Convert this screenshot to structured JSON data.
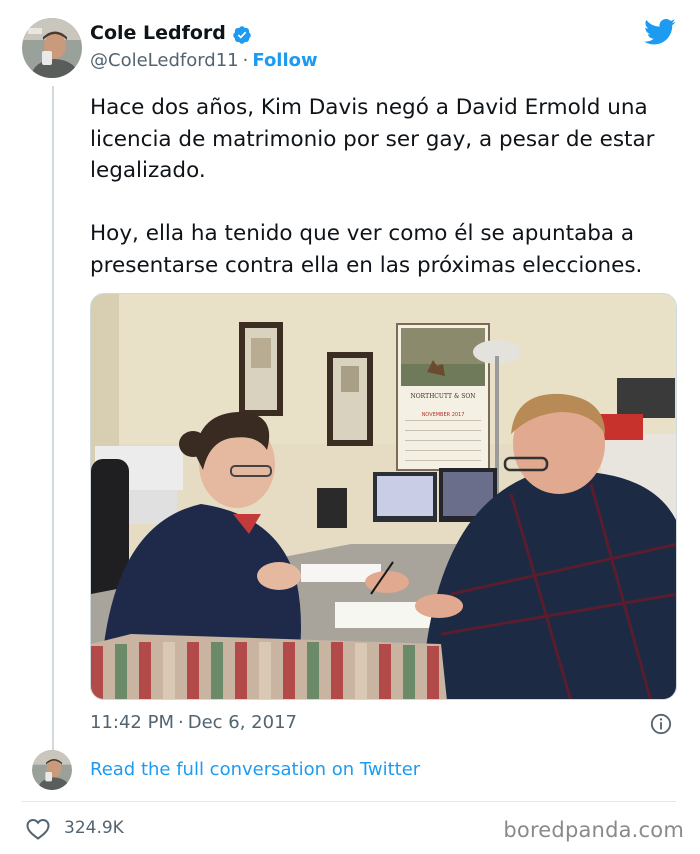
{
  "tweet": {
    "author": {
      "name": "Cole Ledford",
      "handle": "@ColeLedford11",
      "verified": true,
      "follow_label": "Follow",
      "separator": "·"
    },
    "text": "Hace dos años, Kim Davis negó a David Ermold una\nlicencia de matrimonio por ser gay, a pesar de estar\nlegalizado.\n\nHoy, ella ha tenido que ver como él se apuntaba a\npresentarse contra ella en las próximas elecciones.",
    "photo": {
      "calendar_brand": "NORTHCUTT & SON",
      "calendar_month": "NOVEMBER 2017"
    },
    "time": "11:42 PM",
    "date": "Dec 6, 2017",
    "likes": "324.9K",
    "read_more_label": "Read the full conversation on Twitter"
  },
  "icons": {
    "brand": "twitter-bird-icon",
    "verified": "verified-badge-icon",
    "info": "info-icon",
    "like": "heart-icon"
  },
  "colors": {
    "accent": "#1d9bf0",
    "text": "#0f1419",
    "muted": "#536471"
  },
  "watermark": "boredpanda.com"
}
